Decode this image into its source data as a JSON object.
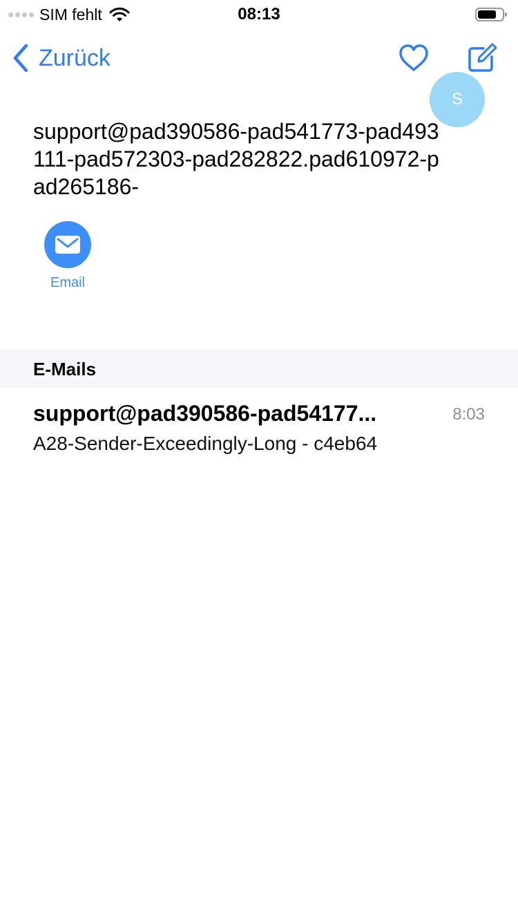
{
  "status_bar": {
    "carrier": "SIM fehlt",
    "time": "08:13",
    "wifi_icon": "wifi-icon",
    "battery_icon": "battery-icon"
  },
  "nav": {
    "back_label": "Zurück",
    "favorite_icon": "heart-icon",
    "compose_icon": "compose-icon"
  },
  "contact": {
    "avatar_initial": "S",
    "name": "support@pad390586-pad541773-pad493111-pad572303-pad282822.pad610972-pad265186-",
    "actions": [
      {
        "label": "Email",
        "icon": "envelope-icon"
      }
    ]
  },
  "emails_section": {
    "title": "E-Mails",
    "items": [
      {
        "sender": "support@pad390586-pad54177...",
        "time": "8:03",
        "subject": "A28-Sender-Exceedingly-Long - c4eb64"
      }
    ]
  },
  "colors": {
    "accent": "#2e7cf6",
    "avatar_bg": "#9bd7f6",
    "section_bg": "#f5f6fa",
    "muted": "#8e8e93"
  }
}
